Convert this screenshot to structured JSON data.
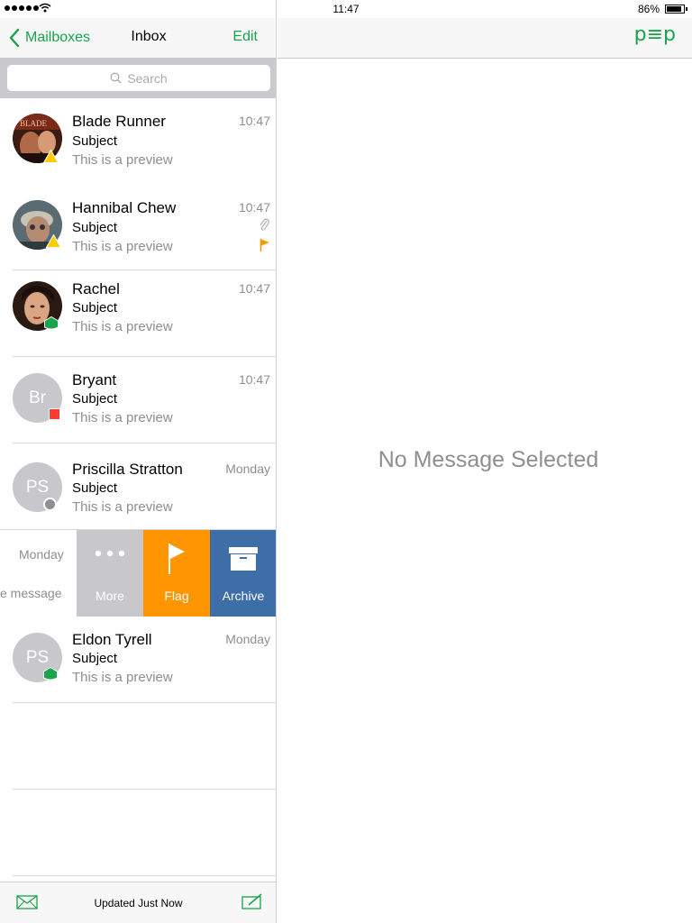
{
  "status_bar": {
    "time": "11:47",
    "battery": "86%"
  },
  "nav": {
    "back_label": "Mailboxes",
    "title": "Inbox",
    "edit_label": "Edit"
  },
  "search": {
    "placeholder": "Search"
  },
  "messages": [
    {
      "name": "Blade Runner",
      "subject": "Subject",
      "preview": "This is a preview",
      "time": "10:47",
      "status": "yellow"
    },
    {
      "name": "Hannibal Chew",
      "subject": "Subject",
      "preview": "This is a preview",
      "time": "10:47",
      "status": "yellow",
      "attachment": true,
      "flagged": true
    },
    {
      "name": "Rachel",
      "subject": "Subject",
      "preview": "This is a preview",
      "time": "10:47",
      "status": "green"
    },
    {
      "name": "Bryant",
      "initials": "Br",
      "subject": "Subject",
      "preview": "This is a preview",
      "time": "10:47",
      "status": "red"
    },
    {
      "name": "Priscilla Stratton",
      "initials": "PS",
      "subject": "Subject",
      "preview": "This is a preview",
      "time": "Monday",
      "status": "grey"
    },
    {
      "name": "Eldon Tyrell",
      "initials": "PS",
      "subject": "Subject",
      "preview": "This is a preview",
      "time": "Monday",
      "status": "green"
    }
  ],
  "swiped_row": {
    "time": "Monday",
    "preview_fragment": "e message",
    "actions": {
      "more": "More",
      "flag": "Flag",
      "archive": "Archive"
    }
  },
  "toolbar": {
    "status": "Updated Just Now"
  },
  "detail": {
    "logo": "p≡p",
    "empty_message": "No Message Selected"
  },
  "colors": {
    "accent": "#1aa34a",
    "more": "#c7c7cc",
    "flag": "#ff9500",
    "archive": "#3d6ea8",
    "yellow": "#ffcc00",
    "green": "#1aa34a",
    "red": "#ff3b30",
    "grey": "#8e8e93"
  }
}
